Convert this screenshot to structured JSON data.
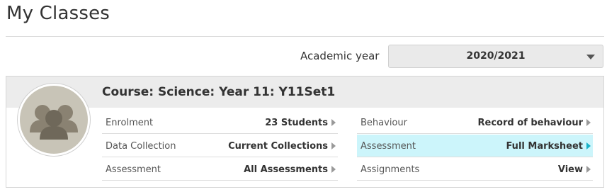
{
  "page": {
    "title": "My Classes"
  },
  "filter": {
    "year_label": "Academic year",
    "year_value": "2020/2021"
  },
  "card": {
    "course_title": "Course: Science: Year 11: Y11Set1",
    "avatar_icon": "users-group-icon",
    "left_rows": [
      {
        "label": "Enrolment",
        "value": "23 Students"
      },
      {
        "label": "Data Collection",
        "value": "Current Collections"
      },
      {
        "label": "Assessment",
        "value": "All Assessments"
      }
    ],
    "right_rows": [
      {
        "label": "Behaviour",
        "value": "Record of behaviour"
      },
      {
        "label": "Assessment",
        "value": "Full Marksheet"
      },
      {
        "label": "Assignments",
        "value": "View"
      }
    ],
    "highlight_color": "#ccf5fb",
    "highlight_arrow_color": "#19b3c8"
  }
}
